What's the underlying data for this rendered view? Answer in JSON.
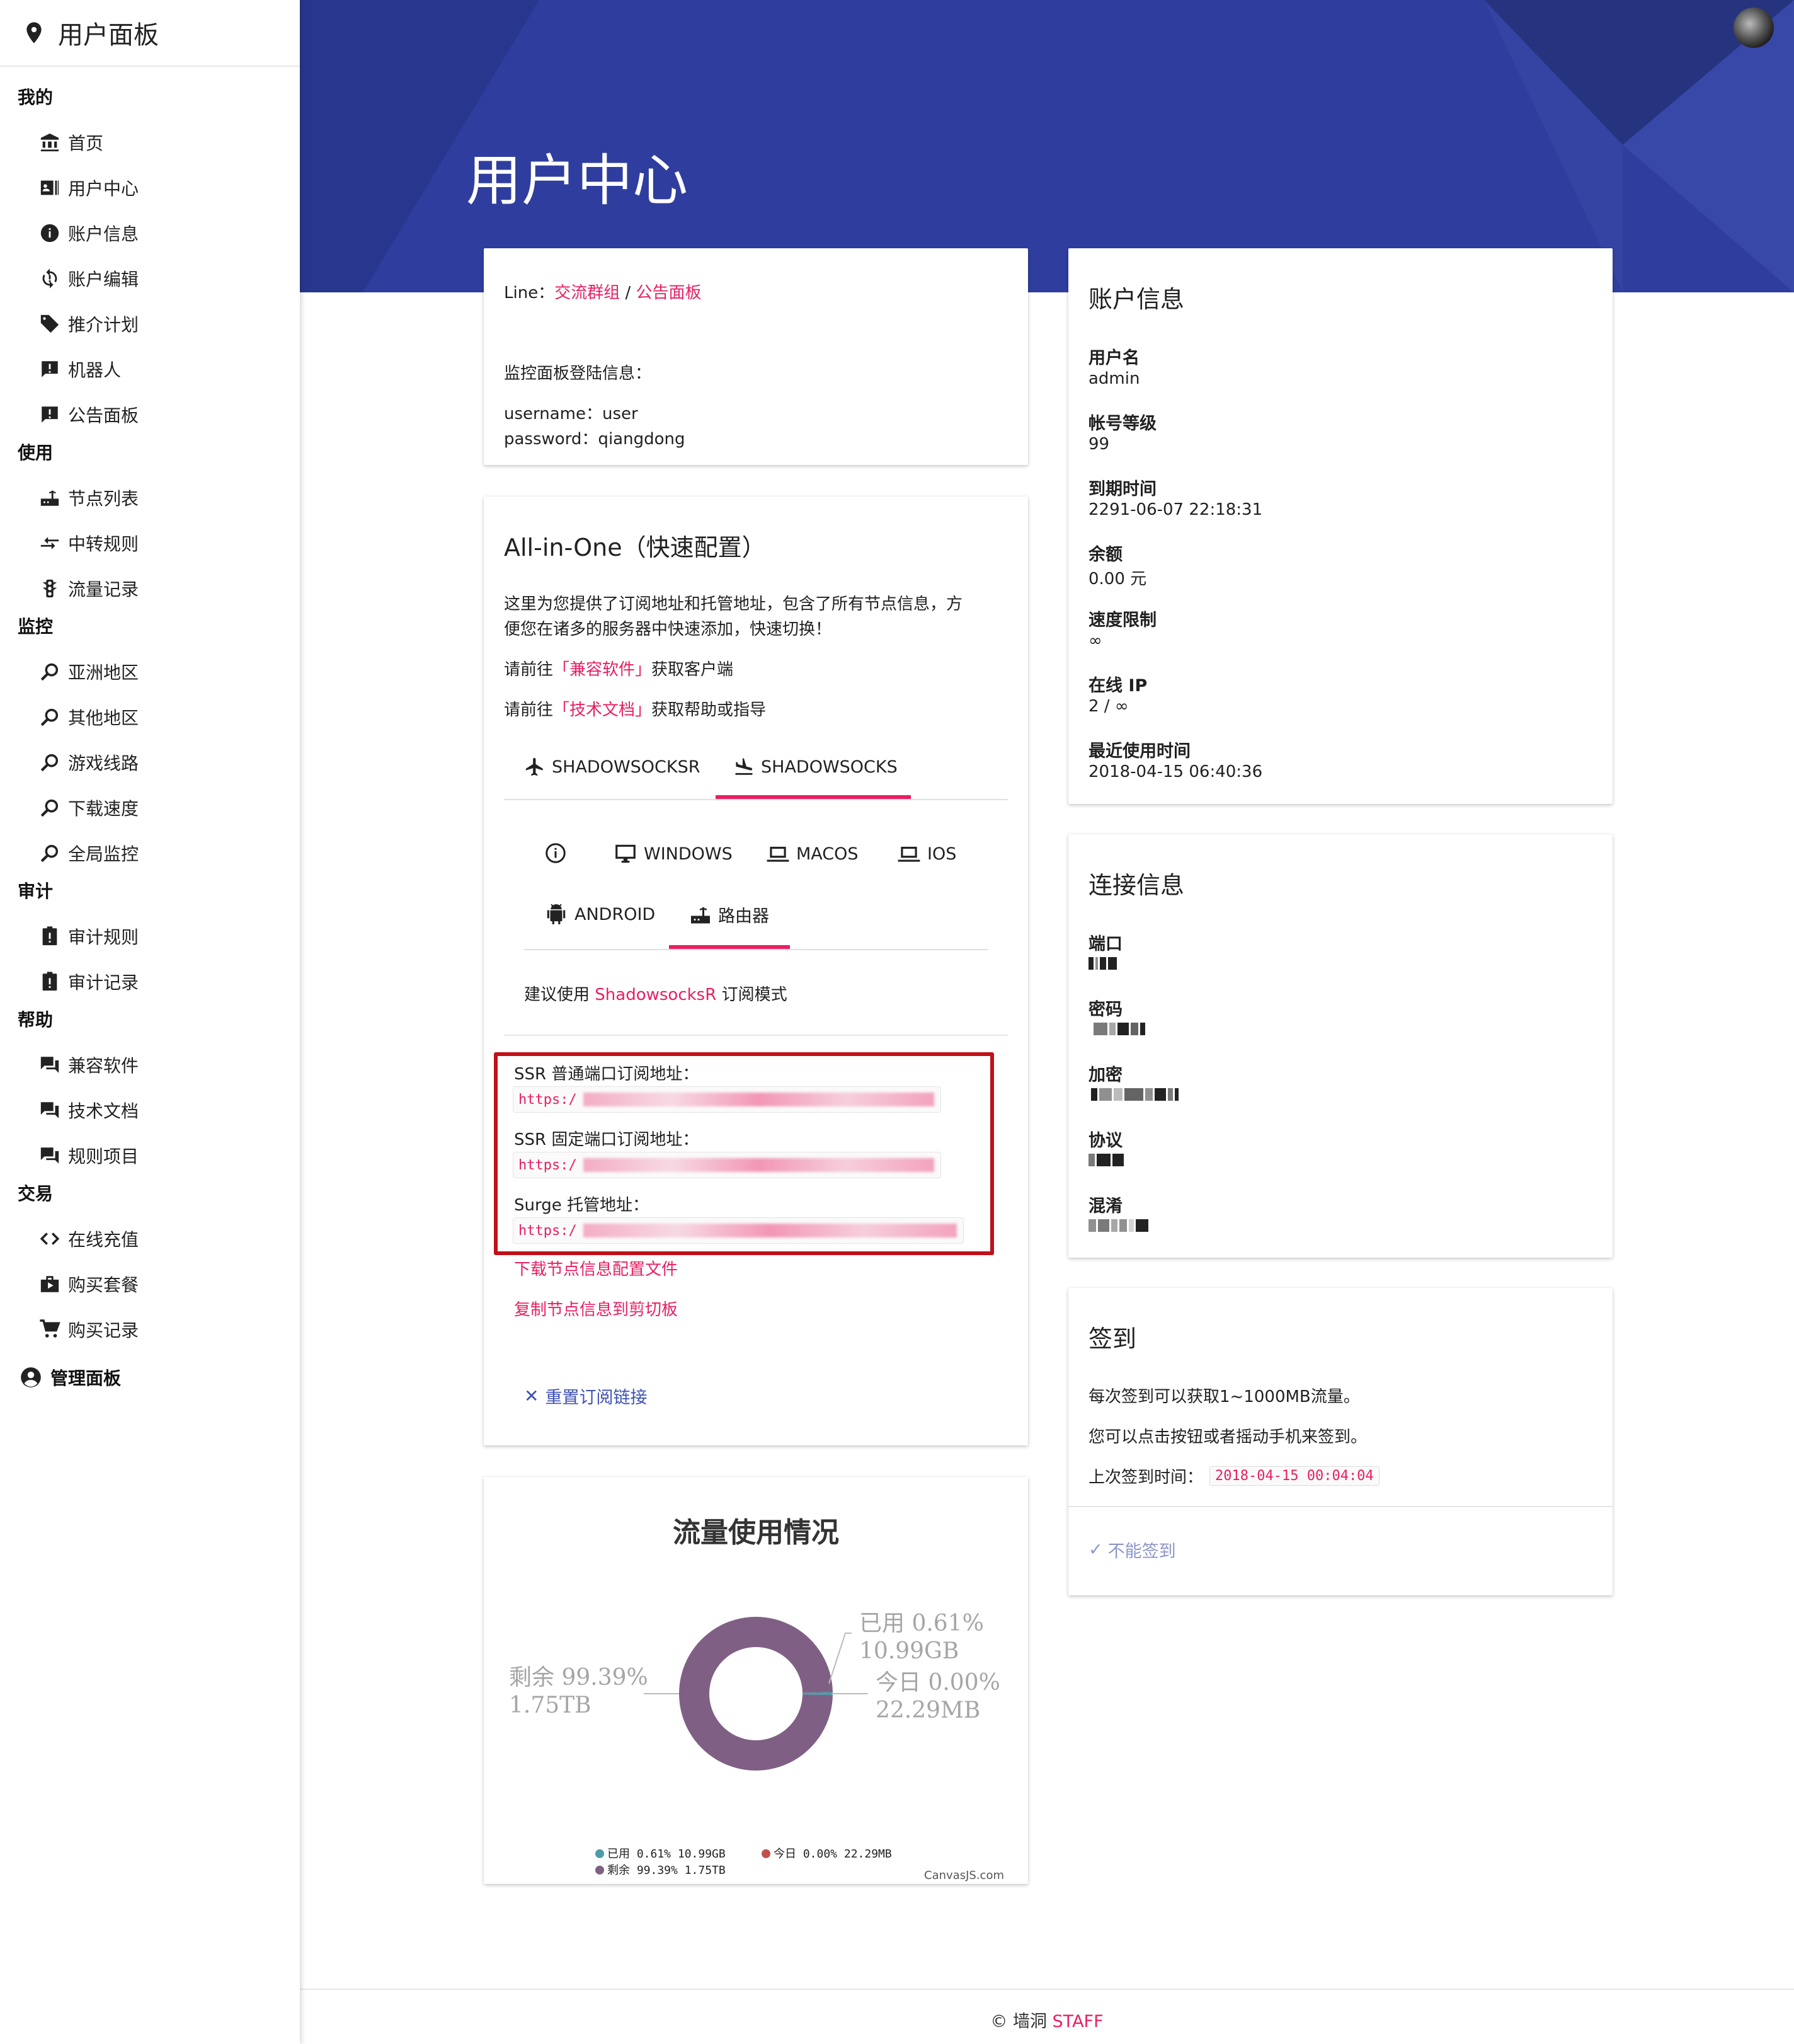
{
  "sidebar": {
    "title": "用户面板",
    "sections": [
      {
        "title": "我的",
        "items": [
          {
            "label": "首页",
            "icon": "bank-icon"
          },
          {
            "label": "用户中心",
            "icon": "account-card-icon"
          },
          {
            "label": "账户信息",
            "icon": "info-icon"
          },
          {
            "label": "账户编辑",
            "icon": "sync-icon"
          },
          {
            "label": "推介计划",
            "icon": "tag-icon"
          },
          {
            "label": "机器人",
            "icon": "feedback-icon"
          },
          {
            "label": "公告面板",
            "icon": "announcement-icon"
          }
        ]
      },
      {
        "title": "使用",
        "items": [
          {
            "label": "节点列表",
            "icon": "router-icon"
          },
          {
            "label": "中转规则",
            "icon": "transfer-icon"
          },
          {
            "label": "流量记录",
            "icon": "traffic-icon"
          }
        ]
      },
      {
        "title": "监控",
        "items": [
          {
            "label": "亚洲地区",
            "icon": "search-icon"
          },
          {
            "label": "其他地区",
            "icon": "search-icon"
          },
          {
            "label": "游戏线路",
            "icon": "search-icon"
          },
          {
            "label": "下载速度",
            "icon": "search-icon"
          },
          {
            "label": "全局监控",
            "icon": "search-icon"
          }
        ]
      },
      {
        "title": "审计",
        "items": [
          {
            "label": "审计规则",
            "icon": "clipboard-alert-icon"
          },
          {
            "label": "审计记录",
            "icon": "clipboard-alert-icon"
          }
        ]
      },
      {
        "title": "帮助",
        "items": [
          {
            "label": "兼容软件",
            "icon": "chat-icon"
          },
          {
            "label": "技术文档",
            "icon": "chat-icon"
          },
          {
            "label": "规则项目",
            "icon": "chat-icon"
          }
        ]
      },
      {
        "title": "交易",
        "items": [
          {
            "label": "在线充值",
            "icon": "code-icon"
          },
          {
            "label": "购买套餐",
            "icon": "shop-icon"
          },
          {
            "label": "购买记录",
            "icon": "cart-icon"
          }
        ]
      }
    ],
    "admin_label": "管理面板"
  },
  "header": {
    "title": "用户中心"
  },
  "line_card": {
    "line_prefix": "Line：",
    "link1": "交流群组",
    "sep": " / ",
    "link2": "公告面板",
    "monitor_title": "监控面板登陆信息：",
    "username_line": "username：user",
    "password_line": "password：qiangdong"
  },
  "aio": {
    "title": "All-in-One（快速配置）",
    "desc1": "这里为您提供了订阅地址和托管地址，包含了所有节点信息，方",
    "desc2": "便您在诸多的服务器中快速添加，快速切换！",
    "goto1_pre": "请前往",
    "goto1_link": "「兼容软件」",
    "goto1_post": "获取客户端",
    "goto2_pre": "请前往",
    "goto2_link": "「技术文档」",
    "goto2_post": "获取帮助或指导",
    "tabs": [
      "SHADOWSOCKSR",
      "SHADOWSOCKS"
    ],
    "subtabs": [
      "WINDOWS",
      "MACOS",
      "IOS",
      "ANDROID",
      "路由器"
    ],
    "suggest_pre": "建议使用",
    "suggest_link": "ShadowsocksR",
    "suggest_post": "订阅模式",
    "ssr_normal_label": "SSR 普通端口订阅地址：",
    "ssr_fixed_label": "SSR 固定端口订阅地址：",
    "surge_label": "Surge 托管地址：",
    "url_prefix1": "https:/",
    "url_prefix2": "https:/",
    "url_prefix3": "https:/",
    "download_link": "下载节点信息配置文件",
    "copy_link": "复制节点信息到剪切板",
    "reset_link": "重置订阅链接"
  },
  "chart_card": {
    "title": "流量使用情况",
    "watermark": "CanvasJS.com"
  },
  "chart_data": {
    "type": "pie",
    "title": "流量使用情况",
    "series": [
      {
        "name": "已用",
        "percent": 0.61,
        "amount": "10.99GB",
        "color": "#4f9aa8"
      },
      {
        "name": "今日",
        "percent": 0.0,
        "amount": "22.29MB",
        "color": "#c0504e"
      },
      {
        "name": "剩余",
        "percent": 99.39,
        "amount": "1.75TB",
        "color": "#7f6084"
      }
    ],
    "labels": {
      "used_line1": "已用 0.61%",
      "used_line2": "10.99GB",
      "today_line1": "今日 0.00%",
      "today_line2": "22.29MB",
      "remain_line1": "剩余 99.39%",
      "remain_line2": "1.75TB"
    },
    "legend": [
      "已用 0.61% 10.99GB",
      "今日 0.00% 22.29MB",
      "剩余 99.39% 1.75TB"
    ]
  },
  "account": {
    "title": "账户信息",
    "fields": [
      {
        "label": "用户名",
        "value": "admin"
      },
      {
        "label": "帐号等级",
        "value": "99"
      },
      {
        "label": "到期时间",
        "value": "2291-06-07 22:18:31"
      },
      {
        "label": "余额",
        "value": "0.00 元"
      },
      {
        "label": "速度限制",
        "value": "∞"
      },
      {
        "label": "在线 IP",
        "value": "2 / ∞"
      },
      {
        "label": "最近使用时间",
        "value": "2018-04-15 06:40:36"
      }
    ]
  },
  "connection": {
    "title": "连接信息",
    "labels": [
      "端口",
      "密码",
      "加密",
      "协议",
      "混淆"
    ]
  },
  "checkin": {
    "title": "签到",
    "line1": "每次签到可以获取1~1000MB流量。",
    "line2": "您可以点击按钮或者摇动手机来签到。",
    "last_label": "上次签到时间：",
    "last_value": "2018-04-15 00:04:04",
    "button": "不能签到"
  },
  "footer": {
    "copyright": "© 墙洞",
    "brand": "STAFF"
  }
}
